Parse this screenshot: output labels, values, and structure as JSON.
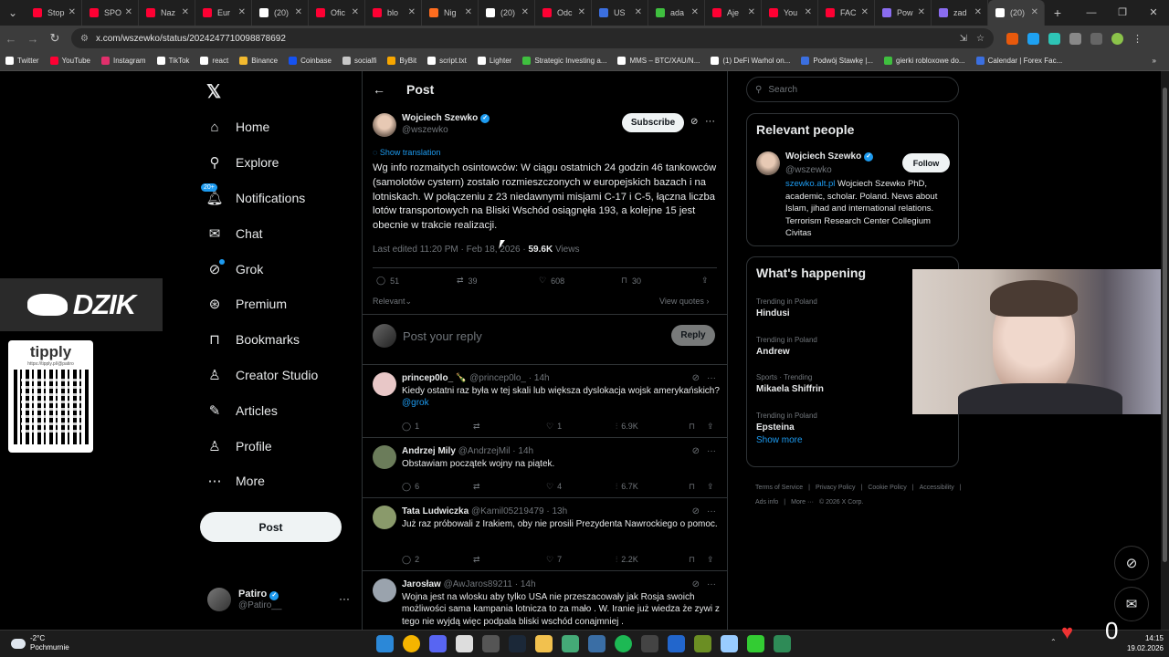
{
  "browser": {
    "tabs": [
      {
        "title": "Stop",
        "color": "#ff0033"
      },
      {
        "title": "SPO",
        "color": "#ff0033"
      },
      {
        "title": "Naz",
        "color": "#ff0033"
      },
      {
        "title": "Eur",
        "color": "#ff0033"
      },
      {
        "title": "(20)",
        "color": "#ffffff"
      },
      {
        "title": "Ofic",
        "color": "#ff0033"
      },
      {
        "title": "blo",
        "color": "#ff0033"
      },
      {
        "title": "Nig",
        "color": "#ff6d1f"
      },
      {
        "title": "(20)",
        "color": "#ffffff"
      },
      {
        "title": "Odc",
        "color": "#ff0033"
      },
      {
        "title": "US",
        "color": "#3b6fe0"
      },
      {
        "title": "ada",
        "color": "#3fbf3f"
      },
      {
        "title": "Aje",
        "color": "#ff0033"
      },
      {
        "title": "You",
        "color": "#ff0033"
      },
      {
        "title": "FAC",
        "color": "#ff0033"
      },
      {
        "title": "Pow",
        "color": "#8a6cf0"
      },
      {
        "title": "zad",
        "color": "#8a6cf0"
      },
      {
        "title": "(20)",
        "color": "#ffffff"
      }
    ],
    "url": "x.com/wszewko/status/2024247710098878692",
    "bookmarks": [
      {
        "label": "Twitter",
        "color": "#ffffff"
      },
      {
        "label": "YouTube",
        "color": "#ff0033"
      },
      {
        "label": "Instagram",
        "color": "#e1306c"
      },
      {
        "label": "TikTok",
        "color": "#ffffff"
      },
      {
        "label": "react",
        "color": "#ffffff"
      },
      {
        "label": "Binance",
        "color": "#f3ba2f"
      },
      {
        "label": "Coinbase",
        "color": "#1652f0"
      },
      {
        "label": "socialfi",
        "color": "#c7c7c7"
      },
      {
        "label": "ByBit",
        "color": "#f7a600"
      },
      {
        "label": "script.txt",
        "color": "#ffffff"
      },
      {
        "label": "Lighter",
        "color": "#ffffff"
      },
      {
        "label": "Strategic Investing a...",
        "color": "#3fbf3f"
      },
      {
        "label": "MMS – BTC/XAU/N...",
        "color": "#ffffff"
      },
      {
        "label": "(1) DeFi Warhol on...",
        "color": "#ffffff"
      },
      {
        "label": "Podwój Stawkę |...",
        "color": "#3b6fe0"
      },
      {
        "label": "gierki robloxowe do...",
        "color": "#3fbf3f"
      },
      {
        "label": "Calendar | Forex Fac...",
        "color": "#3b6fe0"
      }
    ]
  },
  "sidebar": {
    "logo": "𝕏",
    "items": [
      {
        "label": "Home",
        "icon": "⌂"
      },
      {
        "label": "Explore",
        "icon": "⚲"
      },
      {
        "label": "Notifications",
        "icon": "🔔︎",
        "badge": "20+"
      },
      {
        "label": "Chat",
        "icon": "✉"
      },
      {
        "label": "Grok",
        "icon": "⊘"
      },
      {
        "label": "Premium",
        "icon": "⊛"
      },
      {
        "label": "Bookmarks",
        "icon": "⊓"
      },
      {
        "label": "Creator Studio",
        "icon": "♙"
      },
      {
        "label": "Articles",
        "icon": "✎"
      },
      {
        "label": "Profile",
        "icon": "♙"
      },
      {
        "label": "More",
        "icon": "⋯"
      }
    ],
    "post_label": "Post",
    "account": {
      "name": "Patiro",
      "handle": "@Patiro__",
      "more": "···"
    }
  },
  "overlay": {
    "dzik": "DZIK",
    "tipply": "tipply",
    "tipply_url": "https://tipply.pl/@patiro"
  },
  "post": {
    "header": "Post",
    "author": {
      "name": "Wojciech Szewko",
      "handle": "@wszewko"
    },
    "subscribe": "Subscribe",
    "show_translation": "Show translation",
    "text": "Wg info rozmaitych osintowców: W ciągu ostatnich 24 godzin 46 tankowców (samolotów cystern) zostało rozmieszczonych w europejskich bazach i na lotniskach. W połączeniu z 23 niedawnymi misjami C-17 i C-5, łączna liczba lotów transportowych na Bliski Wschód osiągnęła 193, a kolejne 15 jest obecnie w trakcie realizacji.",
    "meta_date": "Last edited 11:20 PM · Feb 18, 2026 · ",
    "views_count": "59.6K",
    "views_label": " Views",
    "stats": {
      "replies": "51",
      "reposts": "39",
      "likes": "608",
      "bookmarks": "30"
    },
    "sort": "Relevant",
    "view_quotes": "View quotes",
    "reply_placeholder": "Post your reply",
    "reply_button": "Reply"
  },
  "replies": [
    {
      "name": "princep0lo_ 🍾",
      "handle": "@princep0lo_",
      "time": "14h",
      "text": "Kiedy ostatni raz była w tej skali lub większa dyslokacja wojsk amerykańskich? ",
      "mention": "@grok",
      "replies": "1",
      "reposts": "",
      "likes": "1",
      "views": "6.9K",
      "avatar": "#e8c7c7"
    },
    {
      "name": "Andrzej Mily",
      "handle": "@AndrzejMil",
      "time": "14h",
      "text": "Obstawiam początek wojny na piątek.",
      "mention": "",
      "replies": "6",
      "reposts": "",
      "likes": "4",
      "views": "6.7K",
      "avatar": "#6b7c5a"
    },
    {
      "name": "Tata Ludwiczka",
      "handle": "@Kamil05219479",
      "time": "13h",
      "text": "Już raz próbowali z Irakiem, oby nie prosili Prezydenta Nawrockiego o pomoc.",
      "mention": "",
      "replies": "2",
      "reposts": "",
      "likes": "7",
      "views": "2.2K",
      "avatar": "#8a9a6b"
    },
    {
      "name": "Jarosław",
      "handle": "@AwJaros89211",
      "time": "14h",
      "text": "Wojna jest na wlosku aby tylko USA nie przeszacowały jak Rosja swoich możliwości sama kampania lotnicza to za mało . W. Iranie już wiedza że zywi z tego nie wyjdą więc podpala bliski wschód conajmniej .",
      "mention": "",
      "replies": "",
      "reposts": "",
      "likes": "",
      "views": "",
      "avatar": "#9aa3ad"
    }
  ],
  "right": {
    "search_placeholder": "Search",
    "relevant_title": "Relevant people",
    "person": {
      "name": "Wojciech Szewko",
      "handle": "@wszewko",
      "follow": "Follow",
      "bio_link": "szewko.alt.pl",
      "bio": " Wojciech Szewko PhD, academic, scholar. Poland. News about Islam, jihad and international relations. Terrorism Research Center Collegium Civitas"
    },
    "happening_title": "What's happening",
    "trends": [
      {
        "context": "Trending in Poland",
        "name": "Hindusi"
      },
      {
        "context": "Trending in Poland",
        "name": "Andrew"
      },
      {
        "context": "Sports · Trending",
        "name": "Mikaela Shiffrin"
      },
      {
        "context": "Trending in Poland",
        "name": "Epsteina"
      }
    ],
    "show_more": "Show more",
    "footer": [
      "Terms of Service",
      "|",
      "Privacy Policy",
      "|",
      "Cookie Policy",
      "|",
      "Accessibility",
      "|",
      "Ads info",
      "|",
      "More ···",
      "© 2026 X Corp."
    ]
  },
  "taskbar": {
    "temp": "-2°C",
    "weather": "Pochmurnie",
    "time": "14:15",
    "date": "19.02.2026",
    "counter": "0"
  }
}
